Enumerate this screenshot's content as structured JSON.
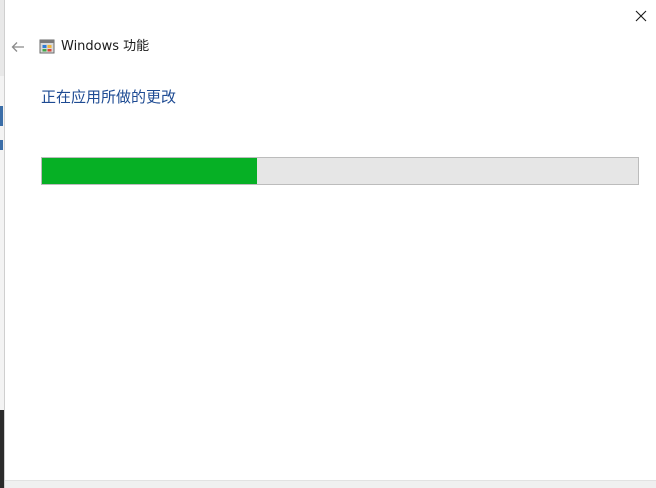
{
  "window": {
    "title": "Windows 功能",
    "app_icon": "windows-features-icon",
    "close_icon": "close-icon",
    "back_icon": "back-arrow-icon"
  },
  "main": {
    "heading": "正在应用所做的更改",
    "progress": {
      "fraction": 0.36,
      "fill_color": "#06b025",
      "track_color": "#e6e6e6"
    }
  },
  "colors": {
    "heading": "#1e4b93",
    "title_text": "#1a1a1a"
  }
}
